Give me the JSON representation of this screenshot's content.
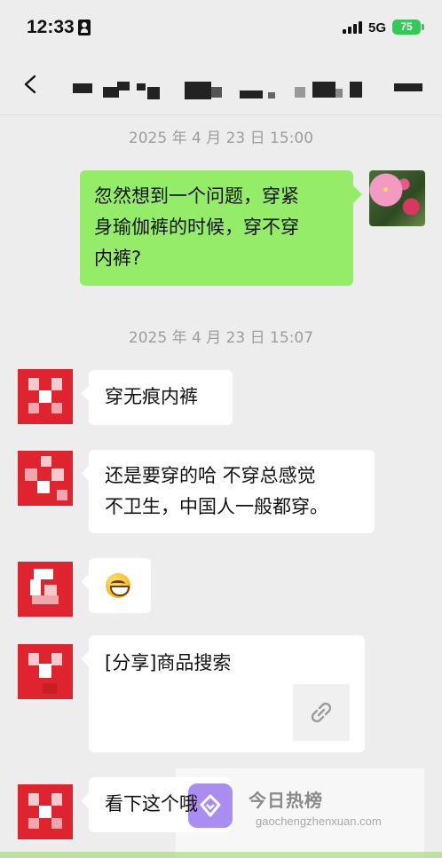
{
  "status_bar": {
    "time": "12:33",
    "network": "5G",
    "battery": "75"
  },
  "nav": {
    "back": "back"
  },
  "messages": {
    "ts1": "2025 年 4 月 23 日 15:00",
    "out1": "忽然想到一个问题，穿紧\n身瑜伽裤的时候，穿不穿\n内裤?",
    "ts2": "2025 年 4 月 23 日 15:07",
    "in1": "穿无痕内裤",
    "in2": "还是要穿的哈  不穿总感觉\n不卫生，中国人一般都穿。",
    "in3_emoji": "grinning-face",
    "in4": "[分享]商品搜索",
    "in5": "看下这个哦"
  },
  "watermark": {
    "title": "今日热榜",
    "url": "gaochengzhenxuan.com"
  },
  "colors": {
    "outgoing_bubble": "#95ec69",
    "incoming_bubble": "#ffffff",
    "background": "#ededed",
    "pixel_red": "#e0242f"
  }
}
